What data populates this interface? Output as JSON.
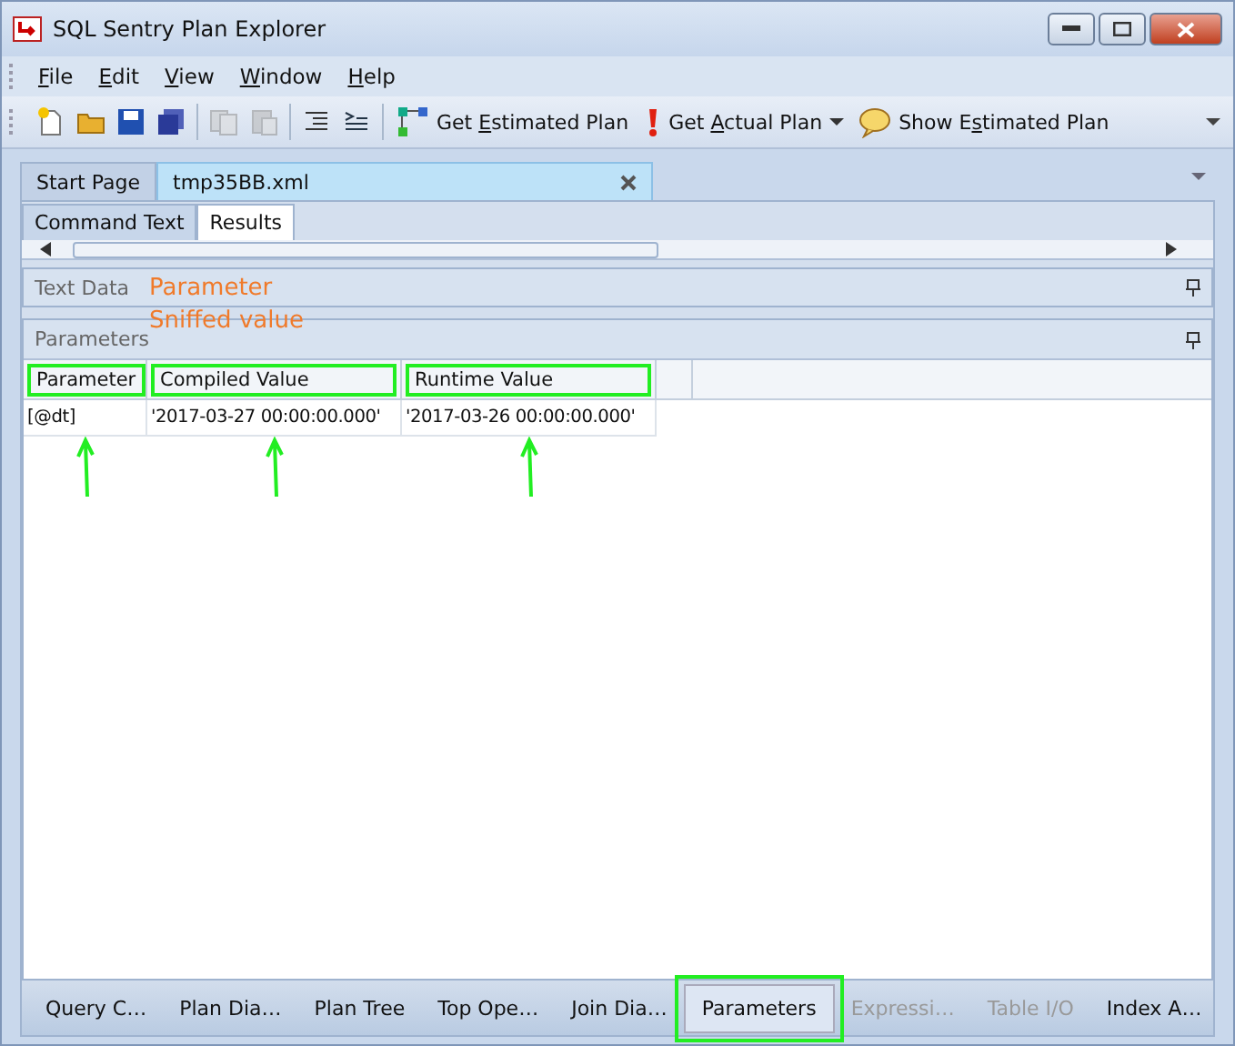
{
  "window": {
    "title": "SQL Sentry Plan Explorer"
  },
  "menu": [
    {
      "label": "File"
    },
    {
      "label": "Edit"
    },
    {
      "label": "View"
    },
    {
      "label": "Window"
    },
    {
      "label": "Help"
    }
  ],
  "toolbar_actions": [
    {
      "kind": "estimated",
      "pre": "Get ",
      "key": "E",
      "rest": "stimated Plan"
    },
    {
      "kind": "actual",
      "pre": "Get ",
      "key": "A",
      "rest": "ctual Plan"
    },
    {
      "kind": "show",
      "pre": "Show E",
      "key": "s",
      "rest": "timated Plan"
    }
  ],
  "doc_tabs": [
    {
      "label": "Start Page",
      "selected": false
    },
    {
      "label": "tmp35BB.xml",
      "selected": true
    }
  ],
  "sub_tabs": [
    {
      "label": "Command Text",
      "selected": false
    },
    {
      "label": "Results",
      "selected": true
    }
  ],
  "panels": [
    {
      "title": "Text Data"
    },
    {
      "title": "Parameters"
    }
  ],
  "annotations": [
    "Parameter",
    "Sniffed value"
  ],
  "grid": {
    "columns": [
      {
        "label": "Parameter",
        "highlighted": true,
        "arrow": true
      },
      {
        "label": "Compiled Value",
        "highlighted": true,
        "arrow": true
      },
      {
        "label": "Runtime Value",
        "highlighted": true,
        "arrow": true
      }
    ],
    "rows": [
      [
        "[@dt]",
        "'2017-03-27 00:00:00.000'",
        "'2017-03-26 00:00:00.000'"
      ]
    ]
  },
  "bottom_tabs": [
    {
      "label": "Query C…",
      "selected": false,
      "disabled": false,
      "highlighted": false
    },
    {
      "label": "Plan Dia…",
      "selected": false,
      "disabled": false,
      "highlighted": false
    },
    {
      "label": "Plan Tree",
      "selected": false,
      "disabled": false,
      "highlighted": false
    },
    {
      "label": "Top Ope…",
      "selected": false,
      "disabled": false,
      "highlighted": false
    },
    {
      "label": "Join Dia…",
      "selected": false,
      "disabled": false,
      "highlighted": false
    },
    {
      "label": "Parameters",
      "selected": true,
      "disabled": false,
      "highlighted": true
    },
    {
      "label": "Expressi…",
      "selected": false,
      "disabled": true,
      "highlighted": false
    },
    {
      "label": "Table I/O",
      "selected": false,
      "disabled": true,
      "highlighted": false
    },
    {
      "label": "Index A…",
      "selected": false,
      "disabled": false,
      "highlighted": false
    }
  ]
}
